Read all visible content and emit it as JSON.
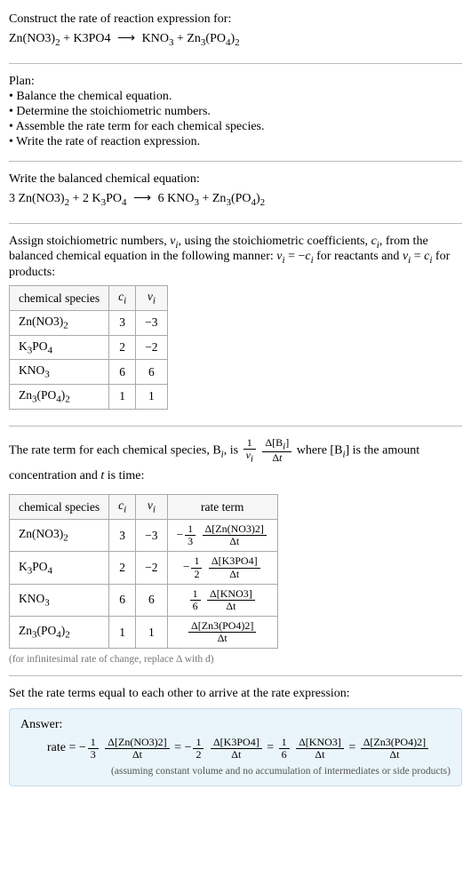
{
  "intro": {
    "prompt": "Construct the rate of reaction expression for:",
    "reactant1": "Zn(NO3)",
    "reactant1_sub": "2",
    "reactant2": "K3PO4",
    "arrow": "⟶",
    "product1": "KNO",
    "product1_sub": "3",
    "product2a": "Zn",
    "product2a_sub": "3",
    "product2b": "(PO",
    "product2b_sub": "4",
    "product2c": ")",
    "product2c_sub": "2"
  },
  "plan": {
    "title": "Plan:",
    "steps": [
      "• Balance the chemical equation.",
      "• Determine the stoichiometric numbers.",
      "• Assemble the rate term for each chemical species.",
      "• Write the rate of reaction expression."
    ]
  },
  "balanced": {
    "title": "Write the balanced chemical equation:",
    "c1": "3",
    "c2": "2",
    "c3": "6"
  },
  "stoich": {
    "intro_a": "Assign stoichiometric numbers, ",
    "nu_i": "ν",
    "intro_b": ", using the stoichiometric coefficients, ",
    "c_i": "c",
    "intro_c": ", from the balanced chemical equation in the following manner: ",
    "rel_reactants": " = −",
    "reactants_tail": " for reactants and ",
    "rel_products": " = ",
    "products_tail": " for products:",
    "headers": [
      "chemical species",
      "cᵢ",
      "νᵢ"
    ],
    "rows": [
      {
        "species_a": "Zn(NO3)",
        "species_sub": "2",
        "c": "3",
        "nu": "−3"
      },
      {
        "species_a": "K",
        "species_sub": "3",
        "species_b": "PO",
        "species_sub2": "4",
        "c": "2",
        "nu": "−2"
      },
      {
        "species_a": "KNO",
        "species_sub": "3",
        "c": "6",
        "nu": "6"
      },
      {
        "species_a": "Zn",
        "species_sub": "3",
        "species_b": "(PO",
        "species_sub2": "4",
        "species_c": ")",
        "species_sub3": "2",
        "c": "1",
        "nu": "1"
      }
    ]
  },
  "rate_term": {
    "intro_a": "The rate term for each chemical species, B",
    "intro_b": ", is ",
    "intro_c": " where [B",
    "intro_d": "] is the amount concentration and ",
    "intro_e": " is time:",
    "headers": [
      "chemical species",
      "cᵢ",
      "νᵢ",
      "rate term"
    ],
    "f1_num": "1",
    "f1_den": "3",
    "d1": "Δ[Zn(NO3)2]",
    "dt": "Δt",
    "f2_num": "1",
    "f2_den": "2",
    "d2": "Δ[K3PO4]",
    "f3_num": "1",
    "f3_den": "6",
    "d3": "Δ[KNO3]",
    "d4": "Δ[Zn3(PO4)2]",
    "note": "(for infinitesimal rate of change, replace Δ with d)"
  },
  "final": {
    "title": "Set the rate terms equal to each other to arrive at the rate expression:",
    "answer_label": "Answer:",
    "rate_label": "rate = ",
    "neg": "−",
    "eq": " = ",
    "caption": "(assuming constant volume and no accumulation of intermediates or side products)"
  },
  "chart_data": {
    "type": "table",
    "tables": [
      {
        "title": "Stoichiometric numbers",
        "columns": [
          "chemical species",
          "cᵢ",
          "νᵢ"
        ],
        "rows": [
          [
            "Zn(NO3)2",
            3,
            -3
          ],
          [
            "K3PO4",
            2,
            -2
          ],
          [
            "KNO3",
            6,
            6
          ],
          [
            "Zn3(PO4)2",
            1,
            1
          ]
        ]
      },
      {
        "title": "Rate terms",
        "columns": [
          "chemical species",
          "cᵢ",
          "νᵢ",
          "rate term"
        ],
        "rows": [
          [
            "Zn(NO3)2",
            3,
            -3,
            "-(1/3) Δ[Zn(NO3)2]/Δt"
          ],
          [
            "K3PO4",
            2,
            -2,
            "-(1/2) Δ[K3PO4]/Δt"
          ],
          [
            "KNO3",
            6,
            6,
            "(1/6) Δ[KNO3]/Δt"
          ],
          [
            "Zn3(PO4)2",
            1,
            1,
            "Δ[Zn3(PO4)2]/Δt"
          ]
        ]
      }
    ],
    "rate_expression": "rate = -(1/3) Δ[Zn(NO3)2]/Δt = -(1/2) Δ[K3PO4]/Δt = (1/6) Δ[KNO3]/Δt = Δ[Zn3(PO4)2]/Δt"
  }
}
